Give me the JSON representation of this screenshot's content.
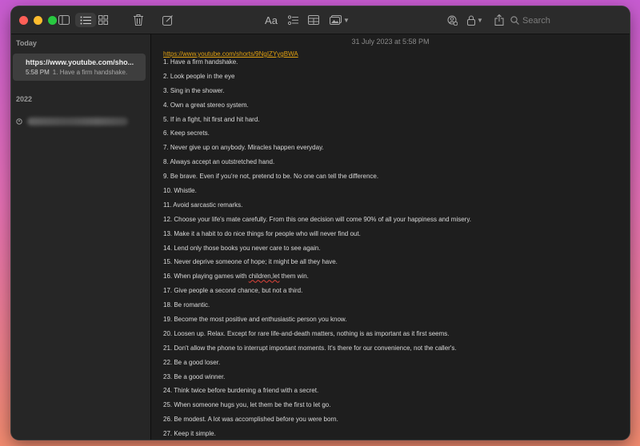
{
  "colors": {
    "window_bg": "#1e1e1e",
    "sidebar_bg": "#262626",
    "selected_note_bg": "#3e3e3e",
    "link": "#e0a010",
    "text": "#d9d9d9"
  },
  "toolbar": {
    "format_label": "Aa",
    "search_placeholder": "Search",
    "icons": [
      "sidebar-toggle-icon",
      "list-view-icon",
      "gallery-view-icon",
      "trash-icon",
      "compose-icon",
      "format-icon",
      "checklist-icon",
      "table-icon",
      "media-icon",
      "collaborate-icon",
      "lock-icon",
      "share-icon",
      "search-icon"
    ]
  },
  "sidebar": {
    "today_label": "Today",
    "year_label": "2022",
    "selected_note": {
      "title": "https://www.youtube.com/sho...",
      "time": "5:58 PM",
      "preview": "1. Have a firm handshake."
    }
  },
  "note": {
    "date": "31 July 2023 at 5:58 PM",
    "link": "https://www.youtube.com/shorts/9NgIZYygBWA",
    "items": [
      "1. Have a firm handshake.",
      "2. Look people in the eye",
      "3. Sing in the shower.",
      "4. Own a great stereo system.",
      "5. If in a fight, hit first and hit hard.",
      "6. Keep secrets.",
      "7. Never give up on anybody. Miracles happen everyday.",
      "8. Always accept an outstretched hand.",
      "9. Be brave. Even if you're not, pretend to be. No one can tell the difference.",
      "10. Whistle.",
      "11. Avoid sarcastic remarks.",
      "12. Choose your life's mate carefully. From this one decision will come 90% of all your happiness and misery.",
      "13. Make it a habit to do nice things for people who will never find out.",
      "14. Lend only those books you never care to see again.",
      "15. Never deprive someone of hope; it might be all they have.",
      "16. When playing games with children,let them win.",
      "17. Give people a second chance, but not a third.",
      "18. Be romantic.",
      "19. Become the most positive and enthusiastic person you know.",
      "20. Loosen up. Relax. Except for rare life-and-death matters, nothing is as important as it first seems.",
      "21. Don't allow the phone to interrupt important moments. It's there for our convenience, not the caller's.",
      "22. Be a good loser.",
      "23. Be a good winner.",
      "24. Think twice before burdening a friend with a secret.",
      "25. When someone hugs you, let them be the first to let go.",
      "26. Be modest. A lot was accomplished before you were born.",
      "27. Keep it simple."
    ]
  }
}
